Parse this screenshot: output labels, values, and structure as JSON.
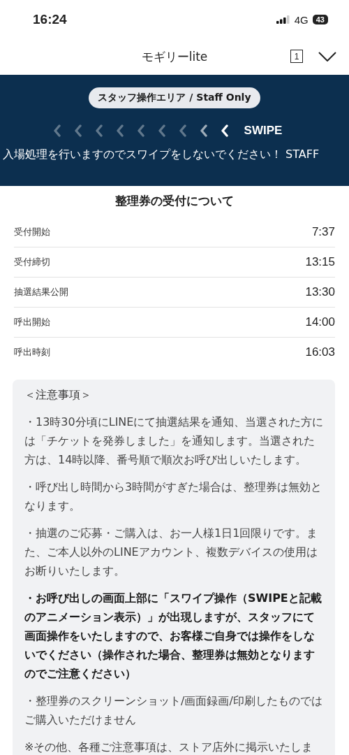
{
  "status_bar": {
    "time": "16:24",
    "network": "4G",
    "battery": "43"
  },
  "header": {
    "title": "モギリーlite",
    "tab_count": "1"
  },
  "staff_banner": {
    "badge": "スタッフ操作エリア / Staff Only",
    "swipe_label": "SWIPE",
    "marquee": "入場処理を行いますのでスワイプをしないでください！ STAFF"
  },
  "section_title": "整理券の受付について",
  "schedule": [
    {
      "label": "受付開始",
      "value": "7:37"
    },
    {
      "label": "受付締切",
      "value": "13:15"
    },
    {
      "label": "抽選結果公開",
      "value": "13:30"
    },
    {
      "label": "呼出開始",
      "value": "14:00"
    },
    {
      "label": "呼出時刻",
      "value": "16:03"
    }
  ],
  "notes": {
    "heading": "＜注意事項＞",
    "items": [
      {
        "text": "・13時30分頃にLINEにて抽選結果を通知、当選された方には「チケットを発券しました」を通知します。当選された方は、14時以降、番号順で順次お呼び出しいたします。",
        "bold": false
      },
      {
        "text": "・呼び出し時間から3時間がすぎた場合は、整理券は無効となります。",
        "bold": false
      },
      {
        "text": "・抽選のご応募・ご購入は、お一人様1日1回限りです。また、ご本人以外のLINEアカウント、複数デバイスの使用はお断りいたします。",
        "bold": false
      },
      {
        "text": "・お呼び出しの画面上部に「スワイプ操作（SWIPEと記載のアニメーション表示）」が出現しますが、スタッフにて画面操作をいたしますので、お客様ご自身では操作をしないでください（操作された場合、整理券は無効となりますのでご注意ください）",
        "bold": true
      },
      {
        "text": "・整理券のスクリーンショット/画面録画/印刷したものではご購入いただけません",
        "bold": false
      },
      {
        "text": "※その他、各種ご注意事項は、ストア店外に掲示いたしま",
        "bold": false
      }
    ]
  }
}
